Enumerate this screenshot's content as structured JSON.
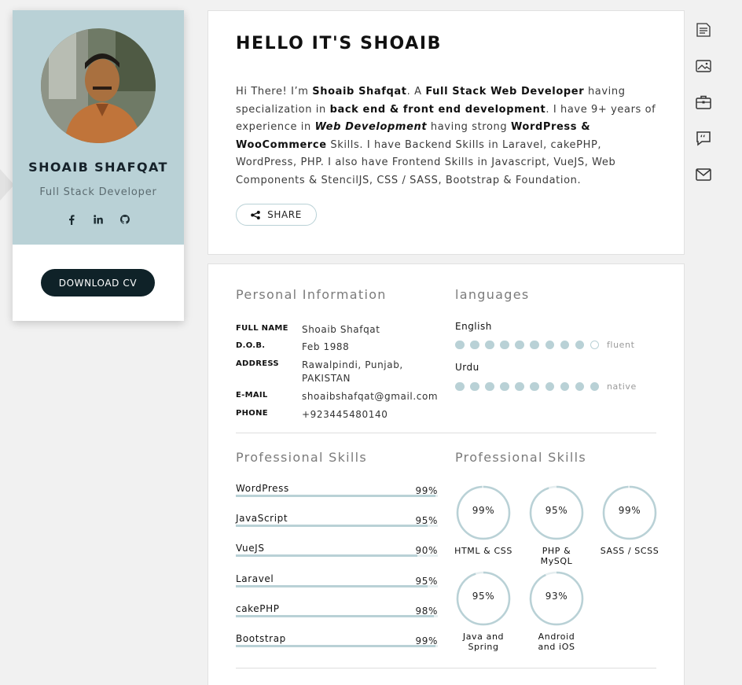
{
  "profile": {
    "name": "SHOAIB SHAFQAT",
    "title": "Full Stack Developer",
    "socials": [
      "facebook-icon",
      "linkedin-icon",
      "github-icon"
    ],
    "download_label": "DOWNLOAD CV"
  },
  "hello": {
    "heading": "HELLO IT'S SHOAIB",
    "intro": [
      {
        "t": "Hi There! I’m ",
        "s": ""
      },
      {
        "t": "Shoaib Shafqat",
        "s": "b"
      },
      {
        "t": ". A ",
        "s": ""
      },
      {
        "t": "Full Stack Web Developer",
        "s": "b"
      },
      {
        "t": " having specialization in  ",
        "s": ""
      },
      {
        "t": "back end & front end development",
        "s": "b"
      },
      {
        "t": ". I have 9+ years of experience in ",
        "s": ""
      },
      {
        "t": "Web Development",
        "s": "bi"
      },
      {
        "t": " having strong ",
        "s": ""
      },
      {
        "t": "WordPress & WooCommerce",
        "s": "b"
      },
      {
        "t": " Skills. I have Backend Skills in Laravel, cakePHP, WordPress, PHP. I also have Frontend Skills in Javascript, VueJS, Web Components  & StencilJS, CSS / SASS, Bootstrap & Foundation.",
        "s": ""
      }
    ],
    "share_label": "SHARE"
  },
  "rail": [
    "resume-icon",
    "portfolio-icon",
    "briefcase-icon",
    "testimonial-icon",
    "mail-icon"
  ],
  "personal": {
    "title": "Personal Information",
    "rows": [
      {
        "key": "FULL NAME",
        "value": "Shoaib Shafqat"
      },
      {
        "key": "D.O.B.",
        "value": "Feb 1988"
      },
      {
        "key": "ADDRESS",
        "value": "Rawalpindi, Punjab, PAKISTAN"
      },
      {
        "key": "E-MAIL",
        "value": "shoaibshafqat@gmail.com"
      },
      {
        "key": "PHONE",
        "value": "+923445480140"
      }
    ]
  },
  "languages": {
    "title": "languages",
    "items": [
      {
        "name": "English",
        "filled": 9,
        "total": 10,
        "level": "fluent"
      },
      {
        "name": "Urdu",
        "filled": 10,
        "total": 10,
        "level": "native"
      }
    ]
  },
  "skills_bars": {
    "title": "Professional Skills",
    "items": [
      {
        "name": "WordPress",
        "pct": 99,
        "label": "99%"
      },
      {
        "name": "JavaScript",
        "pct": 95,
        "label": "95%"
      },
      {
        "name": "VueJS",
        "pct": 90,
        "label": "90%"
      },
      {
        "name": "Laravel",
        "pct": 95,
        "label": "95%"
      },
      {
        "name": "cakePHP",
        "pct": 98,
        "label": "98%"
      },
      {
        "name": "Bootstrap",
        "pct": 99,
        "label": "99%"
      }
    ]
  },
  "skills_circles": {
    "title": "Professional Skills",
    "items": [
      {
        "name": "HTML & CSS",
        "pct": 99,
        "label": "99%"
      },
      {
        "name": "PHP & MySQL",
        "pct": 95,
        "label": "95%"
      },
      {
        "name": "SASS / SCSS",
        "pct": 99,
        "label": "99%"
      },
      {
        "name": "Java and Spring",
        "pct": 95,
        "label": "95%"
      },
      {
        "name": "Android and iOS",
        "pct": 93,
        "label": "93%"
      }
    ]
  },
  "colors": {
    "accent": "#b9d1d6",
    "dark": "#0f2228",
    "track": "#e6eef0"
  }
}
